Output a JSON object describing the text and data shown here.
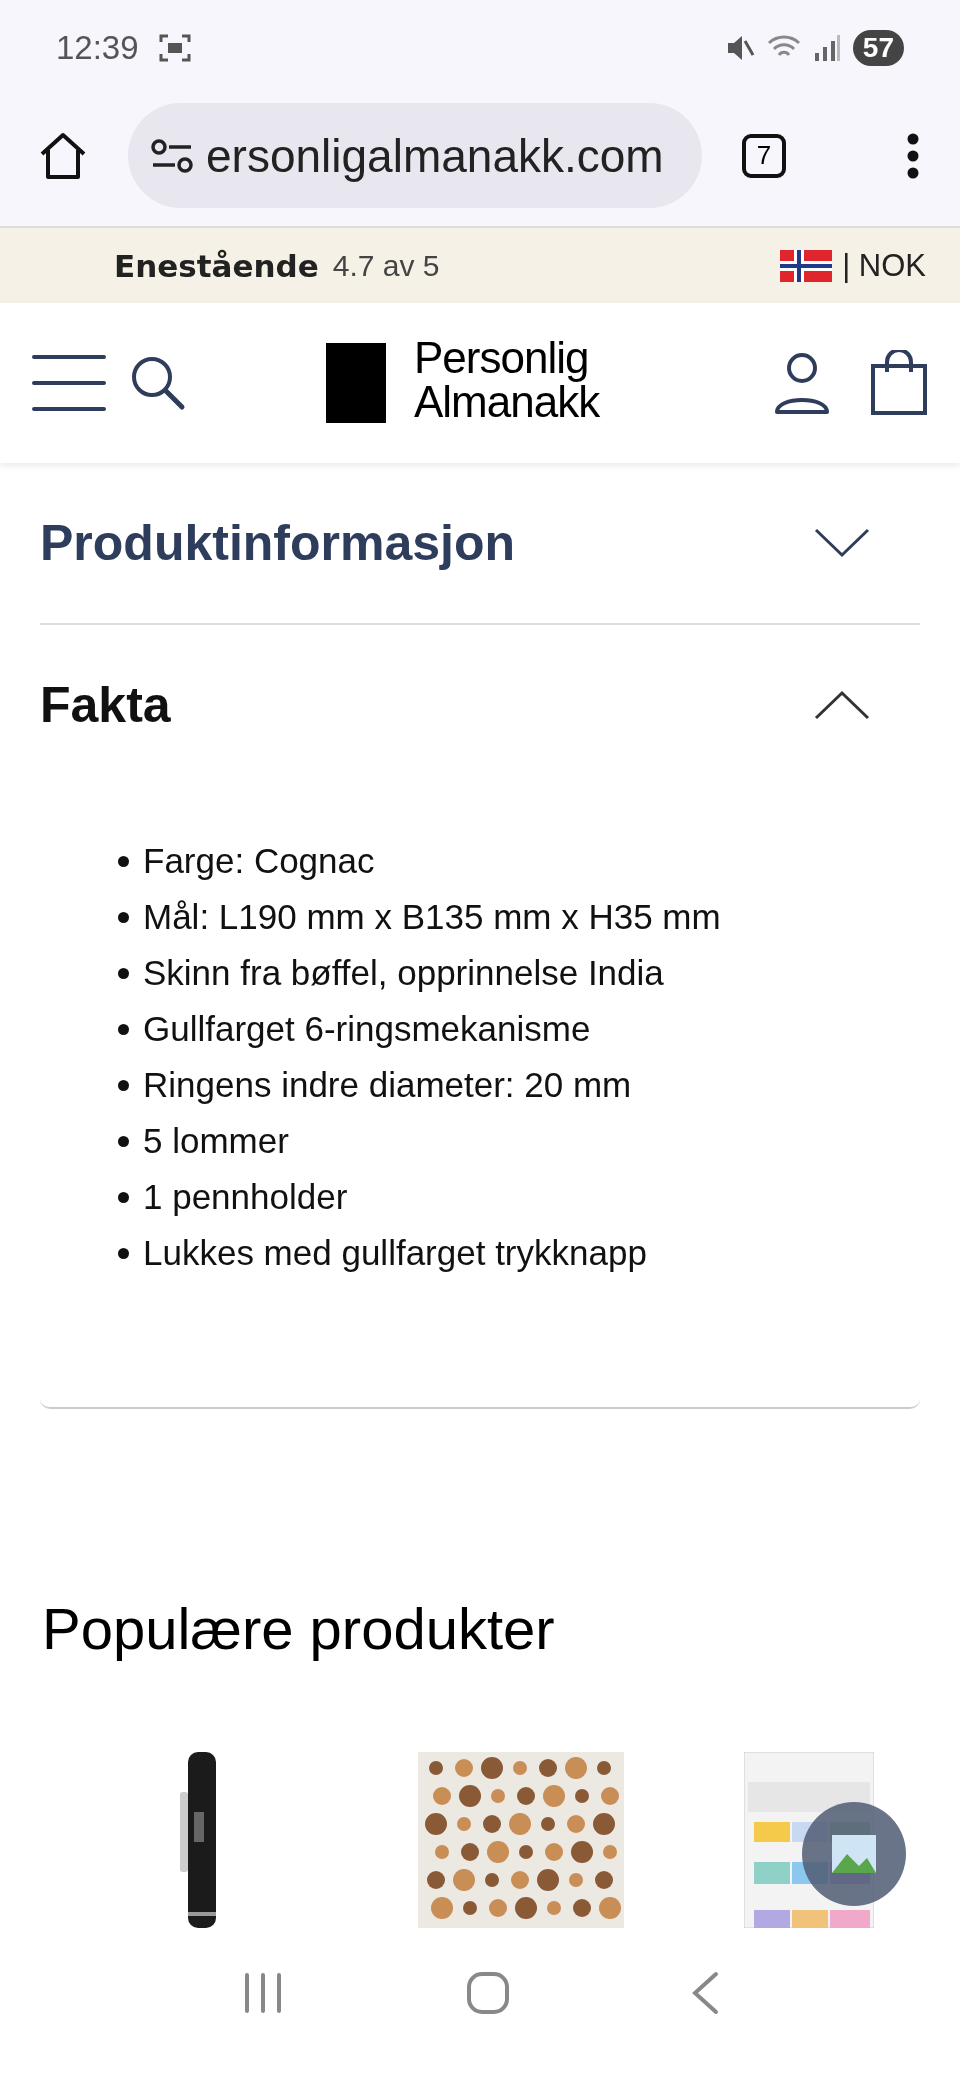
{
  "status_bar": {
    "time": "12:39",
    "battery": "57"
  },
  "browser": {
    "url": "ersonligalmanakk.com",
    "tab_count": "7"
  },
  "promo_bar": {
    "rating_label": "Enestående",
    "rating": "4.7 av 5",
    "currency": "| NOK"
  },
  "header": {
    "logo_lines": [
      "Personlig",
      "Almanakk"
    ]
  },
  "accordion": [
    {
      "title": "Produktinformasjon",
      "expanded": false
    },
    {
      "title": "Fakta",
      "expanded": true,
      "items": [
        "Farge: Cognac",
        "Mål: L190 mm x B135 mm x H35 mm",
        "Skinn fra bøffel, opprinnelse India",
        "Gullfarget 6-ringsmekanisme",
        "Ringens indre diameter: 20 mm",
        "5 lommer",
        "1 pennholder",
        "Lukkes med gullfarget trykknapp"
      ]
    }
  ],
  "popular": {
    "title": "Populære produkter"
  }
}
